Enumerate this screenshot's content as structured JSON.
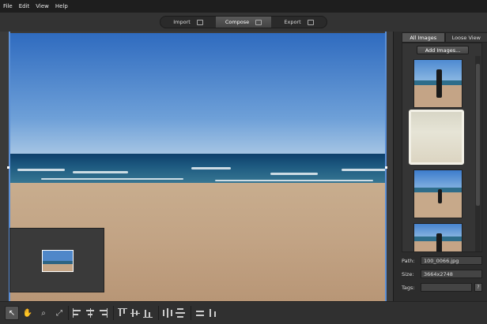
{
  "menu": [
    "File",
    "Edit",
    "View",
    "Help"
  ],
  "modes": [
    {
      "label": "Import",
      "icon": "import-icon"
    },
    {
      "label": "Compose",
      "icon": "compose-icon",
      "active": true
    },
    {
      "label": "Export",
      "icon": "export-icon"
    }
  ],
  "panel": {
    "tabs": [
      "All Images",
      "Loose View"
    ],
    "add_button": "Add Images...",
    "path_label": "Path:",
    "path_value": "100_0066.jpg",
    "size_label": "Size:",
    "size_value": "3664x2748",
    "tags_label": "Tags:",
    "tags_value": "",
    "tags_button": "?"
  },
  "toolbar": [
    "select-tool",
    "hand-tool",
    "zoom-tool",
    "fit-tool",
    "align-left",
    "align-center",
    "align-right",
    "align-top",
    "align-middle",
    "align-bottom",
    "distribute-horizontal",
    "distribute-vertical",
    "rotate",
    "flip"
  ]
}
